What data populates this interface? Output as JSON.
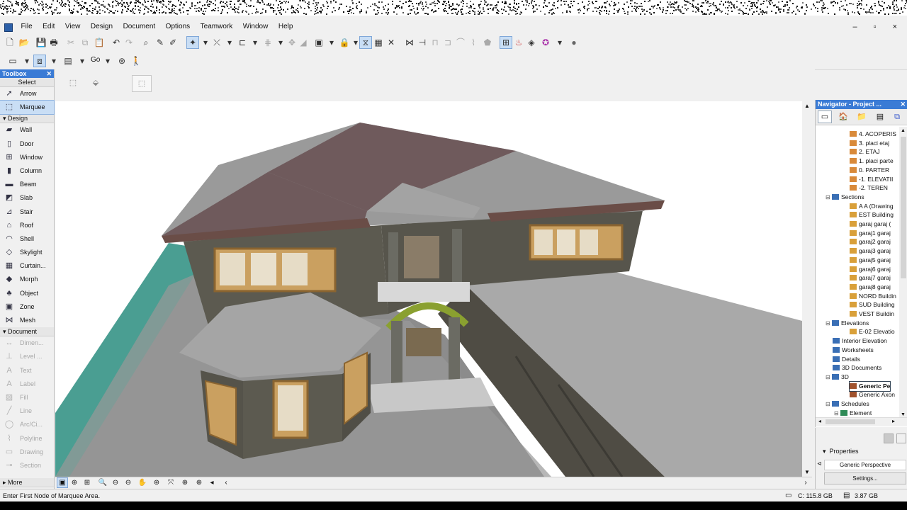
{
  "menu": [
    "File",
    "Edit",
    "View",
    "Design",
    "Document",
    "Options",
    "Teamwork",
    "Window",
    "Help"
  ],
  "window_controls": "– ▫ ×",
  "infobox": {
    "go_label": "Go"
  },
  "toolbox": {
    "title": "Toolbox",
    "select_header": "Select",
    "select_tools": [
      {
        "label": "Arrow",
        "icon": "arrow-icon"
      },
      {
        "label": "Marquee",
        "icon": "marquee-icon"
      }
    ],
    "design_header": "Design",
    "design_tools": [
      {
        "label": "Wall",
        "icon": "wall-icon"
      },
      {
        "label": "Door",
        "icon": "door-icon"
      },
      {
        "label": "Window",
        "icon": "window-icon"
      },
      {
        "label": "Column",
        "icon": "column-icon"
      },
      {
        "label": "Beam",
        "icon": "beam-icon"
      },
      {
        "label": "Slab",
        "icon": "slab-icon"
      },
      {
        "label": "Stair",
        "icon": "stair-icon"
      },
      {
        "label": "Roof",
        "icon": "roof-icon"
      },
      {
        "label": "Shell",
        "icon": "shell-icon"
      },
      {
        "label": "Skylight",
        "icon": "skylight-icon"
      },
      {
        "label": "Curtain...",
        "icon": "curtain-wall-icon"
      },
      {
        "label": "Morph",
        "icon": "morph-icon"
      },
      {
        "label": "Object",
        "icon": "object-icon"
      },
      {
        "label": "Zone",
        "icon": "zone-icon"
      },
      {
        "label": "Mesh",
        "icon": "mesh-icon"
      }
    ],
    "document_header": "Document",
    "document_tools": [
      {
        "label": "Dimen...",
        "icon": "dimension-icon"
      },
      {
        "label": "Level ...",
        "icon": "level-dimension-icon"
      },
      {
        "label": "Text",
        "icon": "text-icon"
      },
      {
        "label": "Label",
        "icon": "label-icon"
      },
      {
        "label": "Fill",
        "icon": "fill-icon"
      },
      {
        "label": "Line",
        "icon": "line-icon"
      },
      {
        "label": "Arc/Ci...",
        "icon": "arc-icon"
      },
      {
        "label": "Polyline",
        "icon": "polyline-icon"
      },
      {
        "label": "Drawing",
        "icon": "drawing-icon"
      },
      {
        "label": "Section",
        "icon": "section-icon"
      }
    ],
    "more_label": "More"
  },
  "navigator": {
    "title": "Navigator - Project ...",
    "tree": [
      {
        "label": "4. ACOPERIS",
        "indent": 4,
        "icon": "story-icon"
      },
      {
        "label": "3. placi etaj",
        "indent": 4,
        "icon": "story-icon"
      },
      {
        "label": "2. ETAJ",
        "indent": 4,
        "icon": "story-icon"
      },
      {
        "label": "1. placi parte",
        "indent": 4,
        "icon": "story-icon"
      },
      {
        "label": "0. PARTER",
        "indent": 4,
        "icon": "story-icon"
      },
      {
        "label": "-1. ELEVATII",
        "indent": 4,
        "icon": "story-icon"
      },
      {
        "label": "-2. TEREN",
        "indent": 4,
        "icon": "story-icon"
      },
      {
        "label": "Sections",
        "indent": 2,
        "icon": "sections-folder-icon",
        "toggle": "−"
      },
      {
        "label": "A A (Drawing",
        "indent": 4,
        "icon": "section-view-icon"
      },
      {
        "label": "EST Building",
        "indent": 4,
        "icon": "section-view-icon"
      },
      {
        "label": "garaj garaj (",
        "indent": 4,
        "icon": "section-view-icon"
      },
      {
        "label": "garaj1 garaj",
        "indent": 4,
        "icon": "section-view-icon"
      },
      {
        "label": "garaj2 garaj",
        "indent": 4,
        "icon": "section-view-icon"
      },
      {
        "label": "garaj3 garaj",
        "indent": 4,
        "icon": "section-view-icon"
      },
      {
        "label": "garaj5 garaj",
        "indent": 4,
        "icon": "section-view-icon"
      },
      {
        "label": "garaj6 garaj",
        "indent": 4,
        "icon": "section-view-icon"
      },
      {
        "label": "garaj7 garaj",
        "indent": 4,
        "icon": "section-view-icon"
      },
      {
        "label": "garaj8 garaj",
        "indent": 4,
        "icon": "section-view-icon"
      },
      {
        "label": "NORD Buildin",
        "indent": 4,
        "icon": "section-view-icon"
      },
      {
        "label": "SUD Building",
        "indent": 4,
        "icon": "section-view-icon"
      },
      {
        "label": "VEST Buildin",
        "indent": 4,
        "icon": "section-view-icon"
      },
      {
        "label": "Elevations",
        "indent": 2,
        "icon": "elevations-folder-icon",
        "toggle": "−"
      },
      {
        "label": "E-02 Elevatio",
        "indent": 4,
        "icon": "section-view-icon"
      },
      {
        "label": "Interior Elevation",
        "indent": 2,
        "icon": "interior-elevations-icon"
      },
      {
        "label": "Worksheets",
        "indent": 2,
        "icon": "worksheets-icon"
      },
      {
        "label": "Details",
        "indent": 2,
        "icon": "details-icon"
      },
      {
        "label": "3D Documents",
        "indent": 2,
        "icon": "3d-documents-icon"
      },
      {
        "label": "3D",
        "indent": 2,
        "icon": "3d-folder-icon",
        "toggle": "−"
      },
      {
        "label": "Generic Pe",
        "indent": 4,
        "icon": "perspective-icon",
        "highlight": true
      },
      {
        "label": "Generic Axon",
        "indent": 4,
        "icon": "axonometry-icon"
      },
      {
        "label": "Schedules",
        "indent": 2,
        "icon": "schedules-folder-icon",
        "toggle": "−"
      },
      {
        "label": "Element",
        "indent": 3,
        "icon": "element-schedule-icon",
        "toggle": "−"
      }
    ]
  },
  "properties": {
    "header": "Properties",
    "view_name": "Generic Perspective",
    "settings_label": "Settings..."
  },
  "status": {
    "message": "Enter First Node of Marquee Area.",
    "disk": "C: 115.8 GB",
    "memory": "3.87 GB"
  },
  "colors": {
    "accent": "#3a7bd5",
    "roof": "#6f5a5c",
    "wall": "#5c5a50",
    "ground": "#4a9e92",
    "pavement": "#8c8c8c",
    "trim": "#c8893a"
  }
}
